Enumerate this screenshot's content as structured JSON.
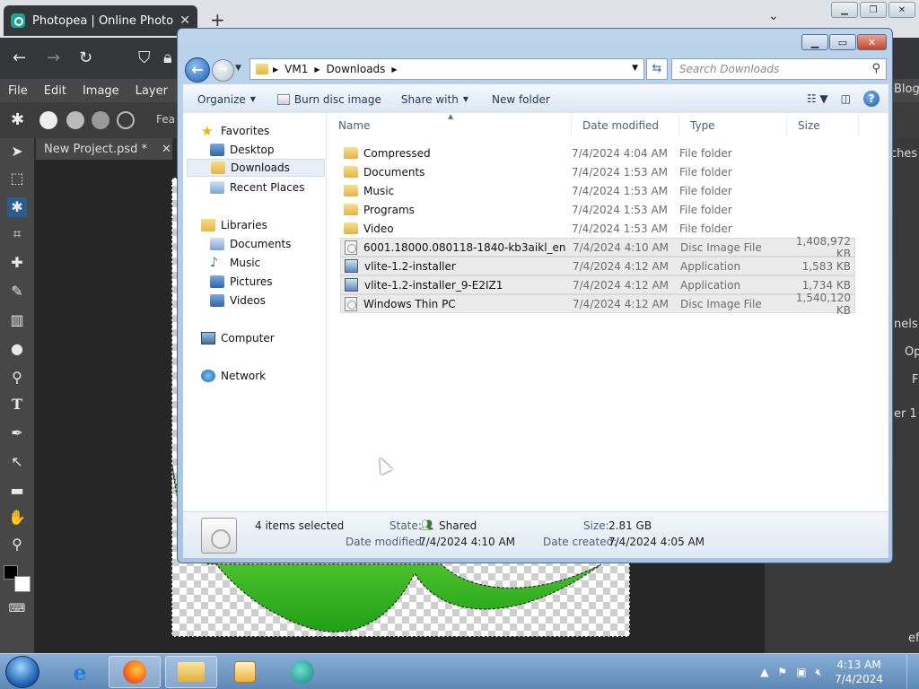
{
  "browser": {
    "tab_title": "Photopea | Online Photo Editor",
    "tab_close": "✕",
    "new_tab": "+",
    "tab_list": "⌄"
  },
  "photopea": {
    "menu": [
      "File",
      "Edit",
      "Image",
      "Layer"
    ],
    "options_partial": "Fea",
    "doc_tab": "New Project.psd *",
    "doc_close": "✕",
    "right_panel": {
      "blog_partial": "Blog",
      "swatches_partial": "ches",
      "channels_partial": "nels",
      "opacity_partial": "Op",
      "fill_partial": "F",
      "layer_partial": "er 1",
      "bottom_partial": "ef"
    }
  },
  "explorer": {
    "caption": {
      "minimize": "▁",
      "maximize": "▭",
      "close": "✕"
    },
    "breadcrumb": [
      "VM1",
      "Downloads"
    ],
    "search_placeholder": "Search Downloads",
    "commands": {
      "organize": "Organize",
      "burn": "Burn disc image",
      "share": "Share with",
      "new_folder": "New folder"
    },
    "nav": {
      "favorites": "Favorites",
      "desktop": "Desktop",
      "downloads": "Downloads",
      "recent": "Recent Places",
      "libraries": "Libraries",
      "documents": "Documents",
      "music": "Music",
      "pictures": "Pictures",
      "videos": "Videos",
      "computer": "Computer",
      "network": "Network"
    },
    "columns": {
      "name": "Name",
      "date": "Date modified",
      "type": "Type",
      "size": "Size"
    },
    "files": [
      {
        "name": "Compressed",
        "date": "7/4/2024 4:04 AM",
        "type": "File folder",
        "size": "",
        "icon": "folder-icon",
        "selected": false
      },
      {
        "name": "Documents",
        "date": "7/4/2024 1:53 AM",
        "type": "File folder",
        "size": "",
        "icon": "folder-icon",
        "selected": false
      },
      {
        "name": "Music",
        "date": "7/4/2024 1:53 AM",
        "type": "File folder",
        "size": "",
        "icon": "folder-icon",
        "selected": false
      },
      {
        "name": "Programs",
        "date": "7/4/2024 1:53 AM",
        "type": "File folder",
        "size": "",
        "icon": "folder-icon",
        "selected": false
      },
      {
        "name": "Video",
        "date": "7/4/2024 1:53 AM",
        "type": "File folder",
        "size": "",
        "icon": "folder-icon",
        "selected": false
      },
      {
        "name": "6001.18000.080118-1840-kb3aikl_en",
        "date": "7/4/2024 4:10 AM",
        "type": "Disc Image File",
        "size": "1,408,972 KB",
        "icon": "disc-image-icon",
        "selected": true
      },
      {
        "name": "vlite-1.2-installer",
        "date": "7/4/2024 4:12 AM",
        "type": "Application",
        "size": "1,583 KB",
        "icon": "application-icon",
        "selected": true
      },
      {
        "name": "vlite-1.2-installer_9-E2IZ1",
        "date": "7/4/2024 4:12 AM",
        "type": "Application",
        "size": "1,734 KB",
        "icon": "application-icon",
        "selected": true
      },
      {
        "name": "Windows Thin PC",
        "date": "7/4/2024 4:12 AM",
        "type": "Disc Image File",
        "size": "1,540,120 KB",
        "icon": "disc-image-icon",
        "selected": true
      }
    ],
    "details": {
      "selection": "4 items selected",
      "state_label": "State:",
      "state_value": "Shared",
      "size_label": "Size:",
      "size_value": "2.81 GB",
      "modified_label": "Date modified:",
      "modified_value": "7/4/2024 4:10 AM",
      "created_label": "Date created:",
      "created_value": "7/4/2024 4:05 AM"
    }
  },
  "taskbar": {
    "time": "4:13 AM",
    "date": "7/4/2024"
  }
}
